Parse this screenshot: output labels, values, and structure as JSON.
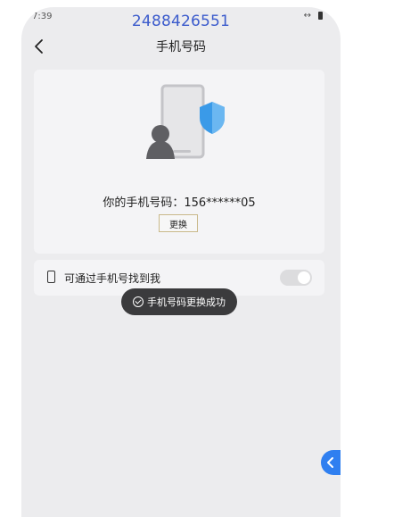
{
  "status_bar": {
    "time": "7:39",
    "icons": [
      "link-arrows-icon",
      "battery-icon"
    ],
    "link_symbol": "↔"
  },
  "overlay_text": "2488426551",
  "nav": {
    "title": "手机号码",
    "back_icon": "chevron-left-icon"
  },
  "main_card": {
    "illustration": "phone-shield-illustration",
    "phone_label": "你的手机号码：156******05",
    "change_button_label": "更换"
  },
  "setting": {
    "label": "可通过手机号找到我",
    "toggle_on": false
  },
  "toast": {
    "text": "手机号码更换成功",
    "icon": "check-circle-icon"
  },
  "floating_button": {
    "icon": "chevron-left-icon",
    "color": "#2f7ff0"
  },
  "colors": {
    "background": "#ececee",
    "card": "#f4f4f6",
    "overlay_text": "#3b5bcc",
    "shield": "#3a9ae8",
    "toast_bg": "#3b3b3d"
  }
}
